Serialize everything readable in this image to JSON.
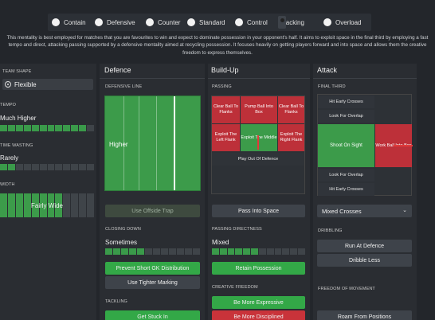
{
  "mentality": {
    "options": [
      "Contain",
      "Defensive",
      "Counter",
      "Standard",
      "Control",
      "Attacking",
      "Overload"
    ],
    "selected": "Attacking"
  },
  "description": "This mentality is best employed for matches that you are favourites to win and expect to dominate possession in your opponent's half. It aims to exploit space in the final third by employing a fast tempo and direct, attacking passing supported by a defensive mentality aimed at recycling possession. It focuses heavily on getting players forward and into space and allows them the creative freedom to express themselves.",
  "left": {
    "team_shape_label": "TEAM SHAPE",
    "team_shape_value": "Flexible",
    "tempo_label": "TEMPO",
    "tempo_value": "Much Higher",
    "tempo_level": 0.95,
    "time_wasting_label": "TIME WASTING",
    "time_wasting_value": "Rarely",
    "time_wasting_level": 0.2,
    "width_label": "WIDTH",
    "width_value": "Fairly Wide",
    "width_level": 0.7
  },
  "defence": {
    "title": "Defence",
    "defensive_line_label": "DEFENSIVE LINE",
    "defensive_line_value": "Higher",
    "offside_trap_button": "Use Offside Trap",
    "closing_down_label": "CLOSING DOWN",
    "closing_down_value": "Sometimes",
    "closing_down_level": 0.45,
    "gk_button": "Prevent Short GK Distribution",
    "marking_button": "Use Tighter Marking",
    "tackling_label": "TACKLING",
    "tackling_button": "Get Stuck In"
  },
  "buildup": {
    "title": "Build-Up",
    "passing_label": "PASSING",
    "grid": {
      "clear_left": "Clear Ball To Flanks",
      "pump": "Pump Ball Into Box",
      "clear_right": "Clear Ball To Flanks",
      "exploit_left": "Exploit The Left Flank",
      "exploit_middle": "Exploit The Middle",
      "exploit_right": "Exploit The Right Flank",
      "play_out": "Play Out Of Defence"
    },
    "pass_into_space_button": "Pass Into Space",
    "directness_label": "PASSING DIRECTNESS",
    "directness_value": "Mixed",
    "directness_level": 0.5,
    "retain_button": "Retain Possession",
    "creative_label": "CREATIVE FREEDOM",
    "expressive_button": "Be More Expressive",
    "disciplined_button": "Be More Disciplined"
  },
  "attack": {
    "title": "Attack",
    "final_third_label": "FINAL THIRD",
    "hit_early_top": "Hit Early Crosses",
    "look_overlap_top": "Look For Overlap",
    "shoot_on_sight": "Shoot On Sight",
    "work_ball": "Work Ball Into Box",
    "look_overlap_bottom": "Look For Overlap",
    "hit_early_bottom": "Hit Early Crosses",
    "crosses_select": "Mixed Crosses",
    "dribbling_label": "DRIBBLING",
    "run_at_defence_button": "Run At Defence",
    "dribble_less_button": "Dribble Less",
    "freedom_label": "FREEDOM OF MOVEMENT",
    "roam_button": "Roam From Positions"
  },
  "colors": {
    "green": "#33a847",
    "red": "#c9333a",
    "panel": "#2a2d32",
    "background": "#23262b"
  }
}
